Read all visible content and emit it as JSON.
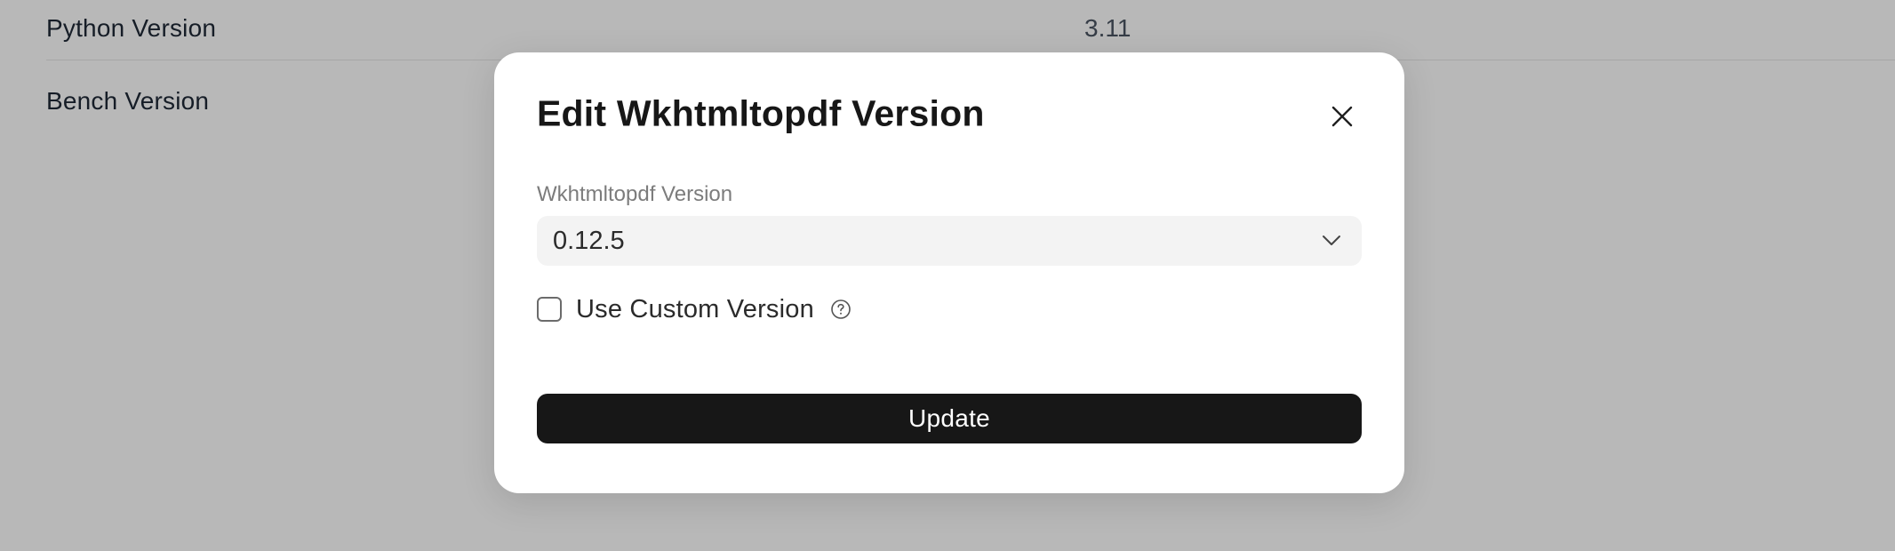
{
  "background": {
    "rows": [
      {
        "label": "Python Version",
        "value": "3.11"
      },
      {
        "label": "Bench Version",
        "value": ""
      }
    ]
  },
  "dialog": {
    "title": "Edit Wkhtmltopdf Version",
    "close_icon": "close-icon",
    "field": {
      "label": "Wkhtmltopdf Version",
      "selected": "0.12.5",
      "icon": "chevron-down-icon"
    },
    "custom": {
      "label": "Use Custom Version",
      "checked": false,
      "help_icon": "question-circle-icon"
    },
    "submit_label": "Update"
  },
  "colors": {
    "overlay": "#b8b8b8",
    "primary_button": "#171717",
    "select_bg": "#f3f3f3"
  }
}
